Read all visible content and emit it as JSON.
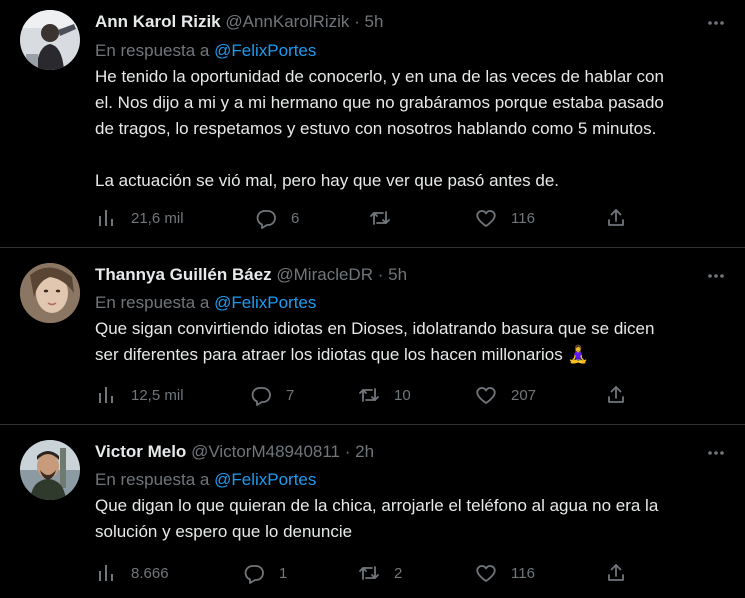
{
  "reply_prefix": "En respuesta a",
  "tweets": [
    {
      "name": "Ann Karol Rizik",
      "handle": "@AnnKarolRizik",
      "separator": "·",
      "time": "5h",
      "reply_to": "@FelixPortes",
      "lines": [
        "He tenido la oportunidad de conocerlo, y en una de las veces de hablar con",
        "el. Nos dijo a mi y a mi hermano que no grabáramos porque estaba pasado",
        "de tragos, lo respetamos y estuvo con nosotros hablando como 5 minutos.",
        "",
        "La actuación se vió mal, pero hay que ver que pasó antes de."
      ],
      "views": "21,6 mil",
      "replies": "6",
      "retweets": "",
      "likes": "116"
    },
    {
      "name": "Thannya Guillén Báez",
      "handle": "@MiracleDR",
      "separator": "·",
      "time": "5h",
      "reply_to": "@FelixPortes",
      "lines": [
        "Que sigan convirtiendo idiotas en Dioses, idolatrando basura que se dicen",
        "ser diferentes para atraer los idiotas que los hacen millonarios"
      ],
      "emoji": "🧘‍♀️",
      "views": "12,5 mil",
      "replies": "7",
      "retweets": "10",
      "likes": "207"
    },
    {
      "name": "Victor Melo",
      "handle": "@VictorM48940811",
      "separator": "·",
      "time": "2h",
      "reply_to": "@FelixPortes",
      "lines": [
        "Que digan lo que quieran de la chica, arrojarle el teléfono al agua no era la",
        "solución y espero que lo denuncie"
      ],
      "views": "8.666",
      "replies": "1",
      "retweets": "2",
      "likes": "116"
    }
  ]
}
